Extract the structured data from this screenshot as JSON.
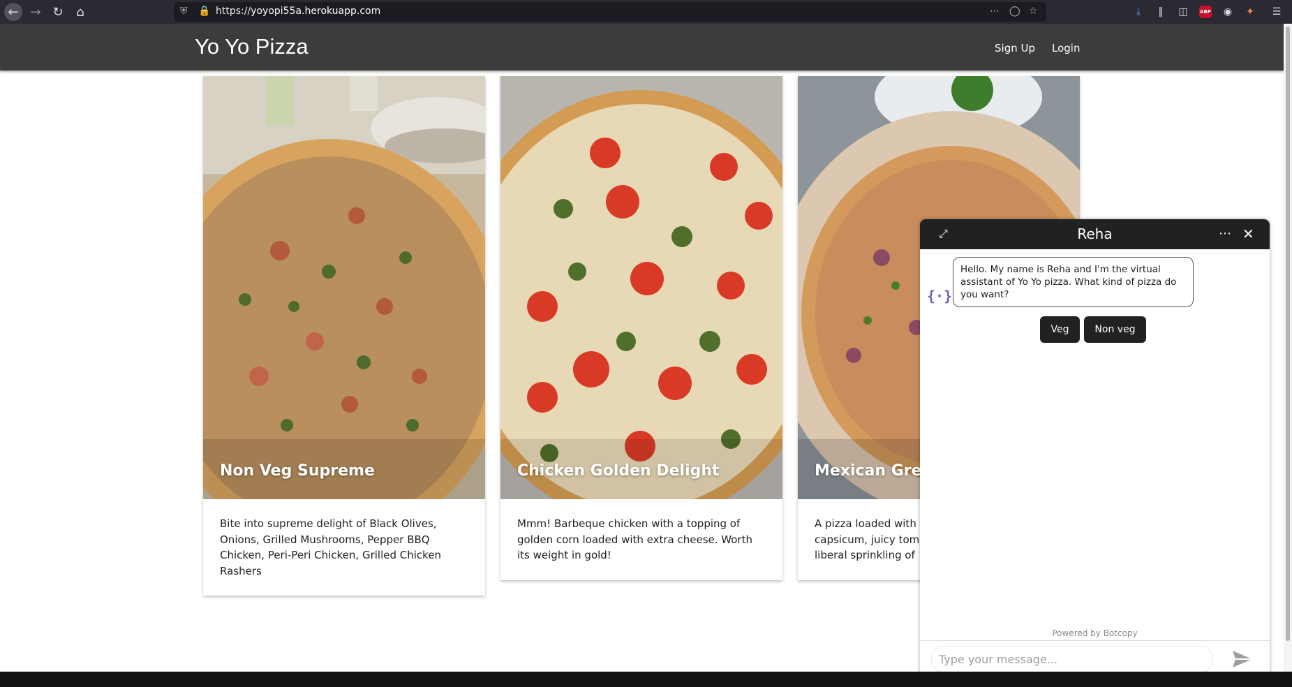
{
  "browser": {
    "url_prefix": "https://",
    "url_host": "yoyopi55a.herokuapp.com",
    "icons": [
      "back-icon",
      "forward-icon",
      "reload-icon",
      "home-icon",
      "shield-icon",
      "lock-icon",
      "more-icon",
      "pocket-icon",
      "star-icon",
      "download-icon",
      "library-icon",
      "sidebar-icon",
      "abp-icon",
      "account-icon",
      "fox-icon",
      "menu-icon"
    ],
    "abp_label": "ABP"
  },
  "site": {
    "brand": "Yo Yo Pizza",
    "nav": {
      "signup": "Sign Up",
      "login": "Login"
    }
  },
  "cards": [
    {
      "title": "Non Veg Supreme",
      "description": "Bite into supreme delight of Black Olives, Onions, Grilled Mushrooms, Pepper BBQ Chicken, Peri-Peri Chicken, Grilled Chicken Rashers"
    },
    {
      "title": "Chicken Golden Delight",
      "description": "Mmm! Barbeque chicken with a topping of golden corn loaded with extra cheese. Worth its weight in gold!"
    },
    {
      "title": "Mexican Gree",
      "description": "A pizza loaded with capsicum, juicy tom liberal sprinkling of"
    }
  ],
  "chat": {
    "title": "Reha",
    "bot_avatar": "{·}",
    "message": "Hello. My name is Reha and I'm the virtual assistant of Yo Yo pizza. What kind of pizza do you want?",
    "quick_replies": {
      "veg": "Veg",
      "non_veg": "Non veg"
    },
    "powered_by": "Powered by Botcopy",
    "input_placeholder": "Type your message..."
  }
}
